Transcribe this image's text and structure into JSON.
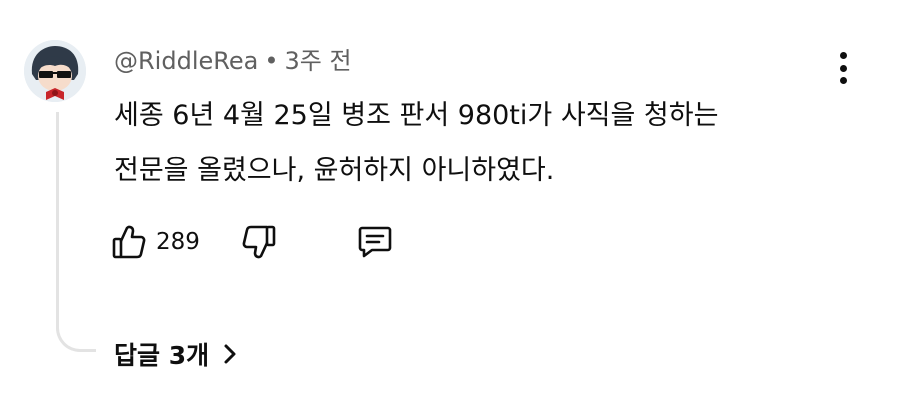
{
  "comment": {
    "author": "@RiddleRea",
    "separator": "•",
    "time": "3주 전",
    "text_lines": [
      "세종 6년 4월 25일 병조 판서 980ti가 사직을 청하는",
      "전문을 올렸으나, 윤허하지 아니하였다."
    ],
    "like_count": "289",
    "replies_label": "답글 3개"
  },
  "icons": {
    "menu": "more-vertical-icon",
    "like": "thumbs-up-icon",
    "dislike": "thumbs-down-icon",
    "reply": "comment-icon",
    "replies_chevron": "chevron-right-icon"
  },
  "colors": {
    "text": "#0f0f0f",
    "meta": "#606060",
    "thread_line": "#e3e3e3"
  }
}
